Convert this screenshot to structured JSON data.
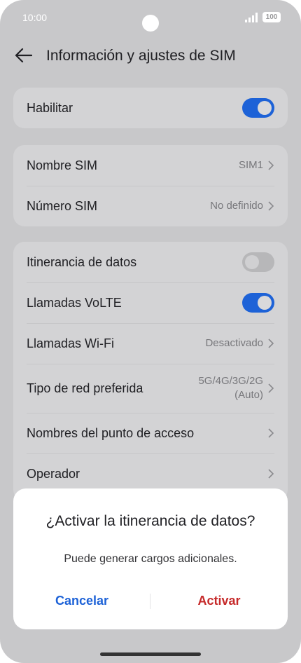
{
  "status_bar": {
    "time": "10:00",
    "battery": "100"
  },
  "header": {
    "title": "Información y ajustes de SIM",
    "back_icon": "back-arrow-icon"
  },
  "card_enable": {
    "label": "Habilitar",
    "toggle_on": true
  },
  "card_sim": {
    "rows": [
      {
        "label": "Nombre SIM",
        "value": "SIM1"
      },
      {
        "label": "Número SIM",
        "value": "No definido"
      }
    ]
  },
  "card_network": {
    "roaming": {
      "label": "Itinerancia de datos",
      "toggle_on": false
    },
    "volte": {
      "label": "Llamadas VoLTE",
      "toggle_on": true
    },
    "wifi_calls": {
      "label": "Llamadas Wi-Fi",
      "value": "Desactivado"
    },
    "network_type": {
      "label": "Tipo de red preferida",
      "value_line1": "5G/4G/3G/2G",
      "value_line2": "(Auto)"
    },
    "apn": {
      "label": "Nombres del punto de acceso"
    },
    "operator": {
      "label": "Operador"
    }
  },
  "dialog": {
    "title": "¿Activar la itinerancia de datos?",
    "message": "Puede generar cargos adicionales.",
    "cancel_label": "Cancelar",
    "activate_label": "Activar"
  },
  "colors": {
    "accent": "#1d62d7",
    "danger": "#c62a2a",
    "overlay_background": "#c8c8ca",
    "card_background": "#d3d3d5"
  }
}
